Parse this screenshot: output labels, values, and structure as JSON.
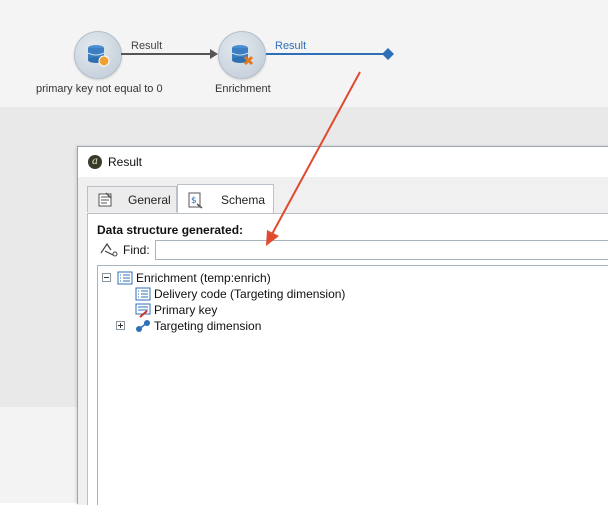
{
  "workflow": {
    "node1_label": "primary key not equal to 0",
    "node2_label": "Enrichment",
    "transition1_label": "Result",
    "transition2_label": "Result",
    "colors": {
      "transition_default": "#555555",
      "transition_selected": "#2f6fb7",
      "annotation_arrow": "#e04a2f"
    }
  },
  "dialog": {
    "title": "Result",
    "title_icon": "app-logo-icon",
    "tabs": [
      {
        "label": "General",
        "icon": "general-tab-icon",
        "active": false
      },
      {
        "label": "Schema",
        "icon": "schema-tab-icon",
        "active": true
      }
    ],
    "section_title": "Data structure generated:",
    "find_label": "Find:",
    "find_value": "",
    "tree": [
      {
        "label": "Enrichment (temp:enrich)",
        "icon": "list-node-icon",
        "expanded": true,
        "depth": 0
      },
      {
        "label": "Delivery code (Targeting dimension)",
        "icon": "list-node-icon",
        "depth": 1
      },
      {
        "label": "Primary key",
        "icon": "key-field-icon",
        "depth": 1
      },
      {
        "label": "Targeting dimension",
        "icon": "link-node-icon",
        "expanded": false,
        "depth": 0
      }
    ]
  }
}
